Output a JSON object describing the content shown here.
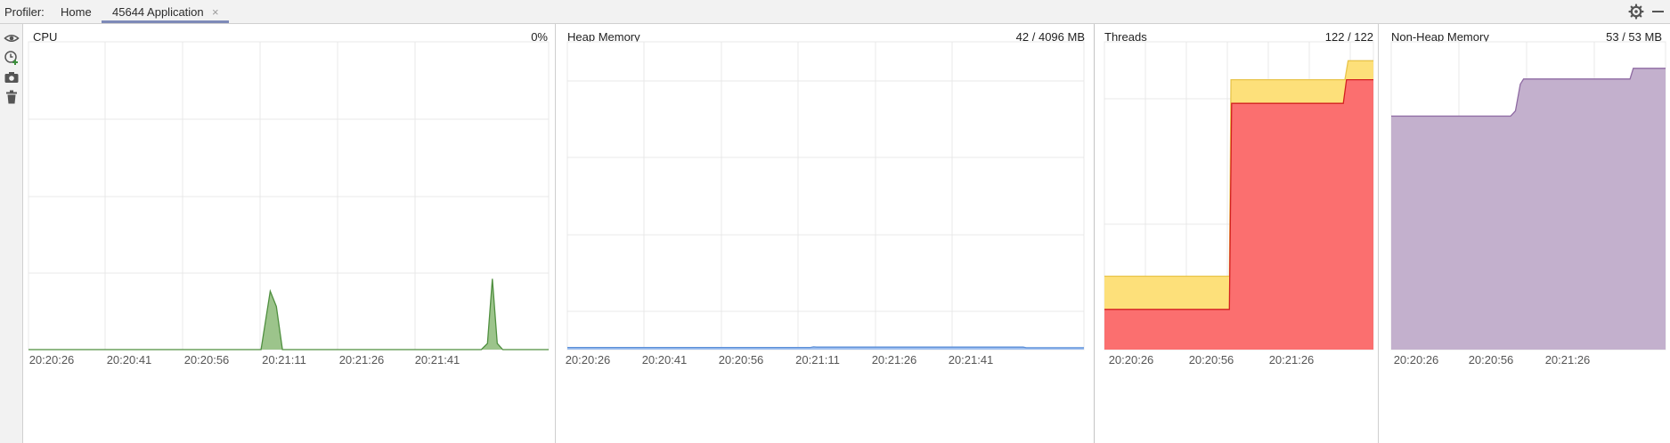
{
  "header": {
    "profiler_label": "Profiler:",
    "tabs": [
      {
        "label": "Home"
      },
      {
        "label": "45644 Application",
        "close": "×"
      }
    ],
    "icons": [
      "gear-icon",
      "minimize-icon"
    ]
  },
  "toolbar": {
    "icons": [
      "eye-icon",
      "add-snapshot-icon",
      "camera-icon",
      "trash-icon"
    ]
  },
  "colors": {
    "cpu_line": "#4f8f3f",
    "cpu_fill": "#9cc48b",
    "heap_line": "#5b8fd8",
    "heap_fill": "#9fbfef",
    "threads_total": "#fde07a",
    "threads_active": "#fb6f6f",
    "threads_active_line": "#d42020",
    "nonheap_fill": "#c3b0cd",
    "nonheap_line": "#8e6aa2",
    "grid": "#e8e8e8"
  },
  "panels": {
    "cpu": {
      "title": "CPU",
      "value": "0%",
      "ticks": [
        "20:20:26",
        "20:20:41",
        "20:20:56",
        "20:21:11",
        "20:21:26",
        "20:21:41"
      ]
    },
    "heap": {
      "title": "Heap Memory",
      "value": "42 / 4096 MB",
      "ticks": [
        "20:20:26",
        "20:20:41",
        "20:20:56",
        "20:21:11",
        "20:21:26",
        "20:21:41"
      ]
    },
    "threads": {
      "title": "Threads",
      "value": "122 / 122",
      "ticks": [
        "20:20:26",
        "20:20:56",
        "20:21:26"
      ]
    },
    "nonheap": {
      "title": "Non-Heap Memory",
      "value": "53 / 53 MB",
      "ticks": [
        "20:20:26",
        "20:20:56",
        "20:21:26"
      ]
    }
  },
  "chart_data": [
    {
      "type": "area",
      "title": "CPU",
      "x_ticks": [
        "20:20:26",
        "20:20:41",
        "20:20:56",
        "20:21:11",
        "20:21:26",
        "20:21:41"
      ],
      "x_range": [
        0,
        85
      ],
      "y_range": [
        0,
        100
      ],
      "series": [
        {
          "values": [
            [
              0,
              0
            ],
            [
              38,
              0
            ],
            [
              39.5,
              19
            ],
            [
              40.5,
              14
            ],
            [
              41.5,
              0
            ],
            [
              74,
              0
            ],
            [
              75,
              2
            ],
            [
              75.8,
              23
            ],
            [
              76.6,
              2
            ],
            [
              77.5,
              0
            ],
            [
              85,
              0
            ]
          ]
        }
      ]
    },
    {
      "type": "area",
      "title": "Heap Memory",
      "x_ticks": [
        "20:20:26",
        "20:20:41",
        "20:20:56",
        "20:21:11",
        "20:21:26",
        "20:21:41"
      ],
      "x_range": [
        0,
        85
      ],
      "y_range": [
        0,
        100
      ],
      "series": [
        {
          "values": [
            [
              0,
              0.7
            ],
            [
              40,
              0.7
            ],
            [
              40.5,
              0.9
            ],
            [
              41,
              0.8
            ],
            [
              75,
              0.8
            ],
            [
              75.5,
              0.6
            ],
            [
              85,
              0.6
            ]
          ]
        }
      ]
    },
    {
      "type": "area",
      "title": "Threads",
      "x_ticks": [
        "20:20:26",
        "20:20:56",
        "20:21:26"
      ],
      "x_range": [
        0,
        85
      ],
      "y_range": [
        0,
        130
      ],
      "series": [
        {
          "values": [
            [
              0,
              31
            ],
            [
              39.5,
              31
            ],
            [
              40,
              114
            ],
            [
              76,
              114
            ],
            [
              77,
              122
            ],
            [
              85,
              122
            ]
          ]
        },
        {
          "values": [
            [
              0,
              17
            ],
            [
              39.5,
              17
            ],
            [
              40.2,
              104
            ],
            [
              75.5,
              104
            ],
            [
              76.5,
              114
            ],
            [
              85,
              114
            ]
          ]
        }
      ]
    },
    {
      "type": "area",
      "title": "Non-Heap Memory",
      "x_ticks": [
        "20:20:26",
        "20:20:56",
        "20:21:26"
      ],
      "x_range": [
        0,
        85
      ],
      "y_range": [
        0,
        58
      ],
      "series": [
        {
          "values": [
            [
              0,
              44
            ],
            [
              37,
              44
            ],
            [
              38.5,
              45
            ],
            [
              40,
              50
            ],
            [
              41,
              51
            ],
            [
              74,
              51
            ],
            [
              75,
              53
            ],
            [
              85,
              53
            ]
          ]
        }
      ]
    }
  ]
}
